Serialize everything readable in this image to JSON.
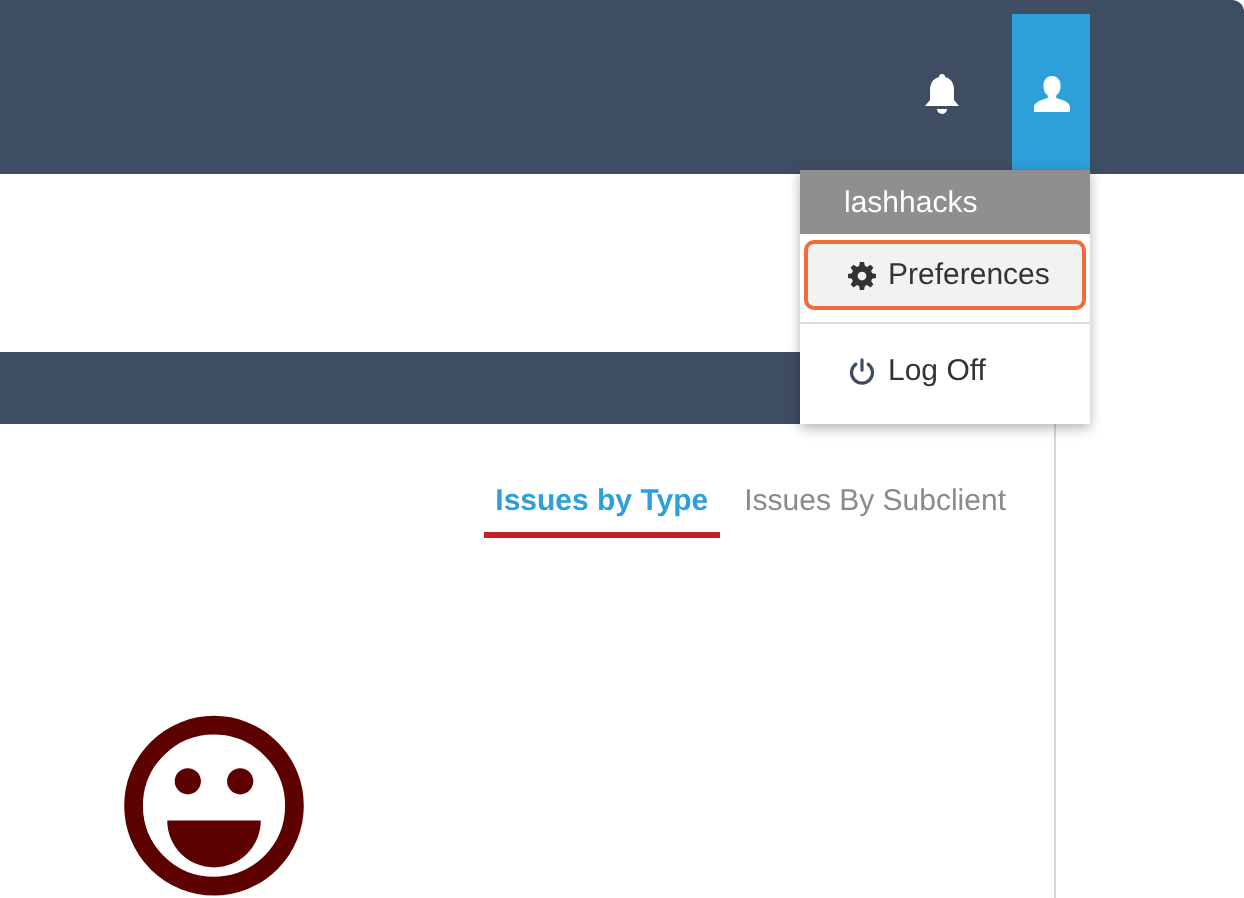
{
  "user_menu": {
    "username": "lashhacks",
    "items": [
      {
        "label": "Preferences",
        "highlighted": true
      },
      {
        "label": "Log Off",
        "highlighted": false
      }
    ]
  },
  "tabs": [
    {
      "label": "Issues by Type",
      "selected": true
    },
    {
      "label": "Issues By Subclient",
      "selected": false
    }
  ]
}
